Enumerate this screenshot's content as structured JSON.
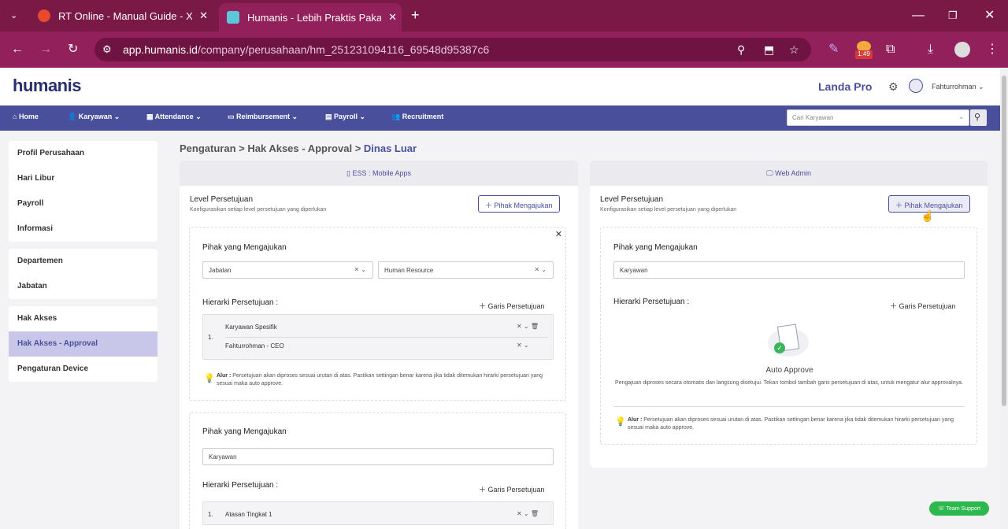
{
  "browser": {
    "tabs": [
      {
        "title": "RT Online - Manual Guide - Xm",
        "active": false
      },
      {
        "title": "Humanis - Lebih Praktis Pakai H",
        "active": true
      }
    ],
    "url_domain": "app.humanis.id",
    "url_path": "/company/perusahaan/hm_251231094116_69548d95387c6",
    "badge_time": "1:49"
  },
  "app": {
    "logo": "humanis",
    "plan": "Landa Pro",
    "user": "Fahturrohman",
    "nav": [
      "Home",
      "Karyawan",
      "Attendance",
      "Reimbursement",
      "Payroll",
      "Recruitment"
    ],
    "search_placeholder": "Cari Karyawan"
  },
  "sidebar": {
    "group1": [
      "Profil Perusahaan",
      "Hari Libur",
      "Payroll",
      "Informasi"
    ],
    "group2": [
      "Departemen",
      "Jabatan"
    ],
    "group3": [
      "Hak Akses",
      "Hak Akses - Approval",
      "Pengaturan Device"
    ],
    "active": "Hak Akses - Approval"
  },
  "breadcrumb": {
    "a": "Pengaturan",
    "b": "Hak Akses - Approval",
    "c": "Dinas Luar",
    "sep": ">"
  },
  "ess": {
    "header": "ESS : Mobile Apps",
    "level_title": "Level Persetujuan",
    "level_sub": "Konfigurasikan setiap level persetujuan yang diperlukan",
    "add_btn": "Pihak Mengajukan",
    "block1": {
      "pihak_label": "Pihak yang Mengajukan",
      "sel1": "Jabatan",
      "sel2": "Human Resource",
      "hier_label": "Hierarki Persetujuan :",
      "garis": "Garis Persetujuan",
      "num": "1.",
      "row1": "Karyawan Spesifik",
      "row2": "Fahturrohman - CEO",
      "note_b": "Alur :",
      "note": " Persetujuan akan diproses sesuai urutan di atas. Pastikan settingan benar karena jika tidak ditemukan hirarki persetujuan yang sesuai maka auto approve."
    },
    "block2": {
      "pihak_label": "Pihak yang Mengajukan",
      "sel1": "Karyawan",
      "hier_label": "Hierarki Persetujuan :",
      "garis": "Garis Persetujuan",
      "num": "1.",
      "row1": "Atasan Tingkat 1"
    }
  },
  "web": {
    "header": "Web Admin",
    "level_title": "Level Persetujuan",
    "level_sub": "Konfigurasikan setiap level persetujuan yang diperlukan",
    "add_btn": "Pihak Mengajukan",
    "pihak_label": "Pihak yang Mengajukan",
    "sel1": "Karyawan",
    "hier_label": "Hierarki Persetujuan :",
    "garis": "Garis Persetujuan",
    "auto_title": "Auto Approve",
    "auto_desc": "Pengajuan diproses secara otomatis dan langsung disetujui. Tekan tombol tambah garis persetujuan di atas, untuk mengatur alur approvalnya.",
    "note_b": "Alur :",
    "note": " Persetujuan akan diproses sesuai urutan di atas. Pastikan settingan benar karena jika tidak ditemukan hirarki persetujuan yang sesuai maka auto approve."
  },
  "support": "Team Support"
}
